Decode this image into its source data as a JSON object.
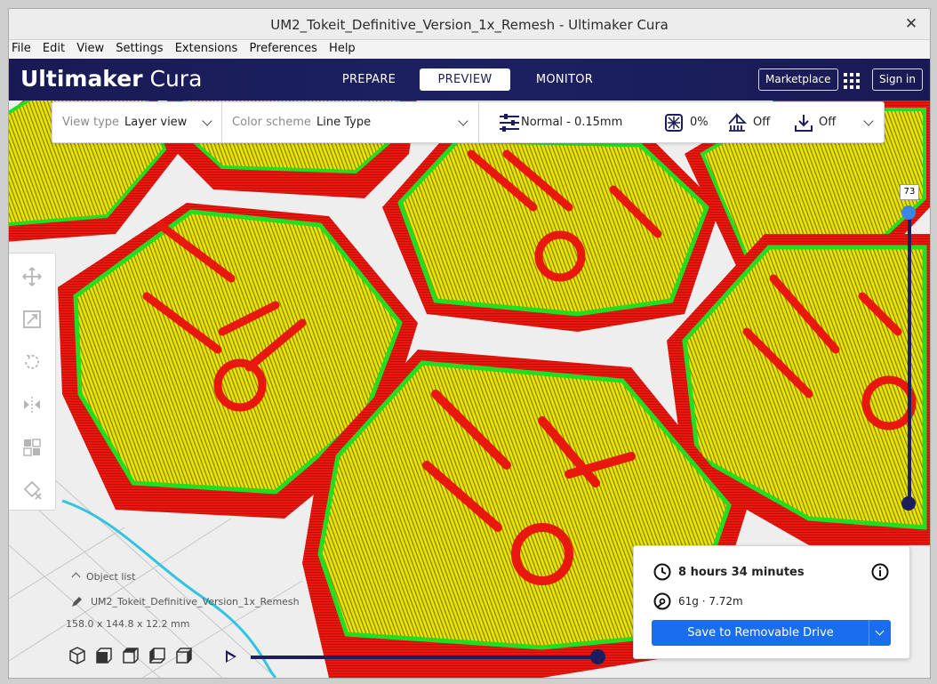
{
  "window": {
    "title": "UM2_Tokeit_Definitive_Version_1x_Remesh - Ultimaker Cura",
    "close_symbol": "✕"
  },
  "menubar": [
    "File",
    "Edit",
    "View",
    "Settings",
    "Extensions",
    "Preferences",
    "Help"
  ],
  "header": {
    "logo_bold": "Ultimaker",
    "logo_light": " Cura",
    "stages": [
      "PREPARE",
      "PREVIEW",
      "MONITOR"
    ],
    "active_stage": "PREVIEW",
    "marketplace": "Marketplace",
    "signin": "Sign in"
  },
  "toolbar": {
    "view_type_label": "View type",
    "view_type_value": "Layer view",
    "color_scheme_label": "Color scheme",
    "color_scheme_value": "Line Type",
    "profile": "Normal - 0.15mm",
    "infill": "0%",
    "support": "Off",
    "adhesion": "Off"
  },
  "layer_slider": {
    "current_layer": "73"
  },
  "object": {
    "list_label": "Object list",
    "name": "UM2_Tokeit_Definitive_Version_1x_Remesh",
    "dimensions": "158.0 x 144.8 x 12.2 mm"
  },
  "print_info": {
    "time": "8 hours 34 minutes",
    "material": "61g · 7.72m",
    "save_button": "Save to Removable Drive"
  },
  "colors": {
    "header_bg": "#1c1d55",
    "accent_blue": "#196ef0",
    "wall_red": "#e8180f",
    "skin_yellow": "#e6e600",
    "inner_wall_green": "#22dd22"
  }
}
